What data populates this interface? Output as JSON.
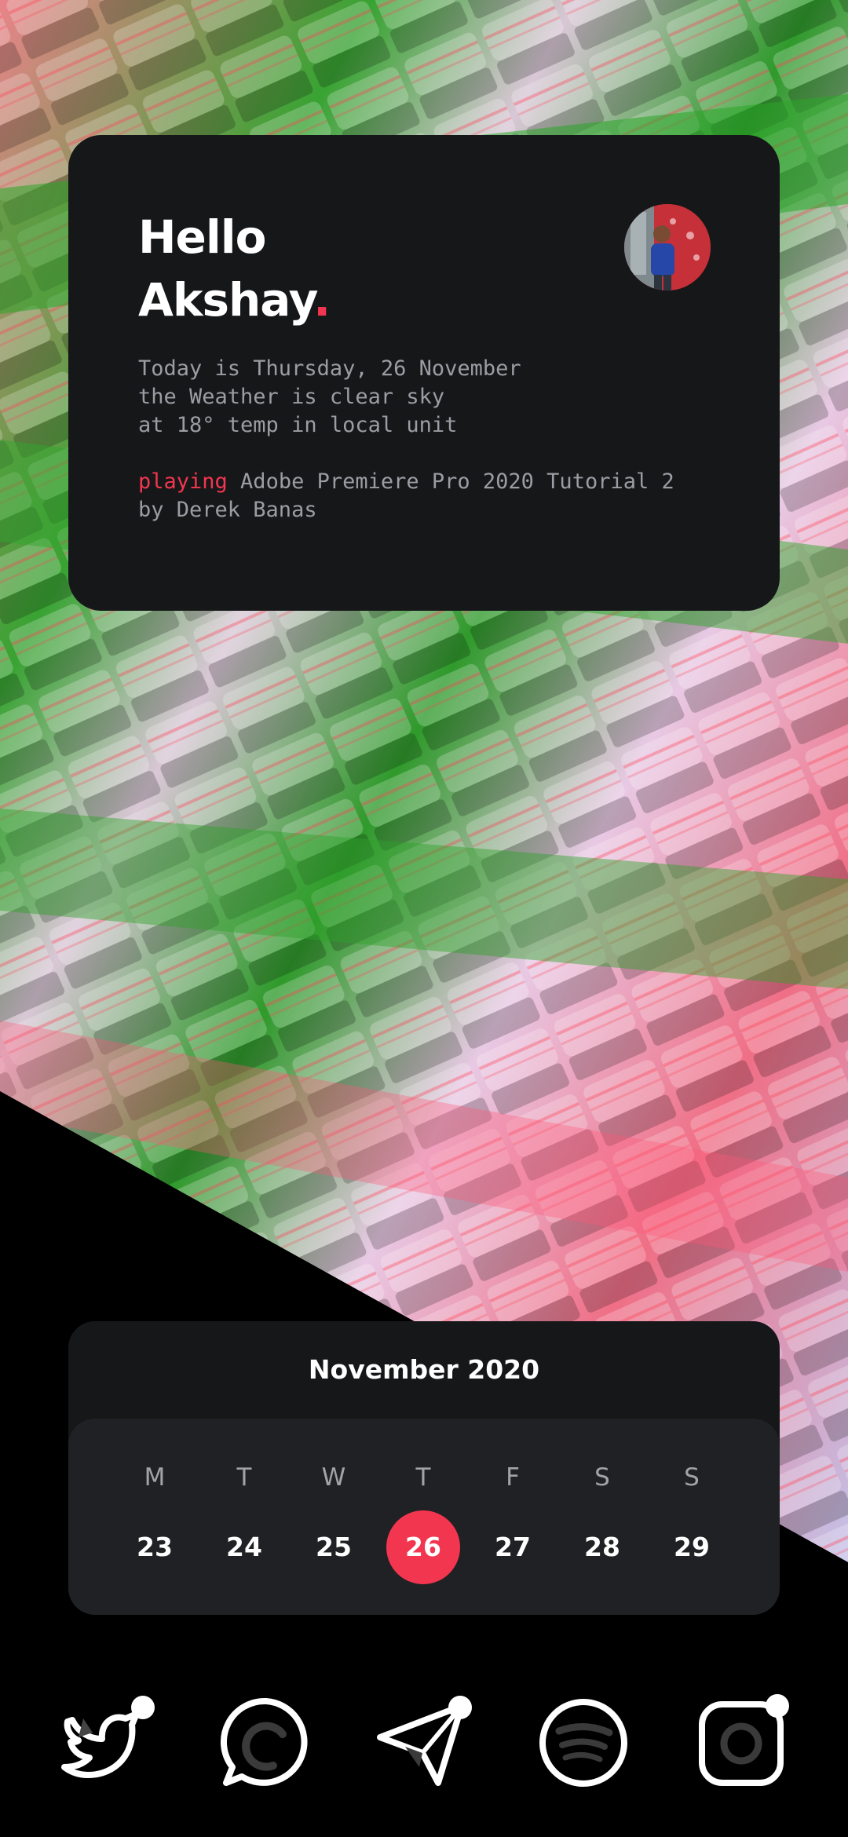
{
  "greeting": {
    "hello": "Hello",
    "name": "Akshay",
    "dot": "."
  },
  "info": {
    "line1": "Today is Thursday, 26 November",
    "line2": "the Weather is clear sky",
    "line3": "at 18° temp in local unit",
    "playing_label": "playing",
    "track_line1": " Adobe Premiere Pro 2020 Tutorial 2",
    "track_line2": "by Derek Banas"
  },
  "calendar": {
    "title": "November 2020",
    "weekdays": [
      "M",
      "T",
      "W",
      "T",
      "F",
      "S",
      "S"
    ],
    "days": [
      "23",
      "24",
      "25",
      "26",
      "27",
      "28",
      "29"
    ],
    "today": "26"
  },
  "dock": {
    "apps": [
      "twitter-icon",
      "whatsapp-icon",
      "telegram-icon",
      "spotify-icon",
      "instagram-icon"
    ]
  },
  "colors": {
    "accent": "#f2364f",
    "card": "#161719",
    "calendar_body": "#202124",
    "muted_text": "#9a9ea3"
  }
}
